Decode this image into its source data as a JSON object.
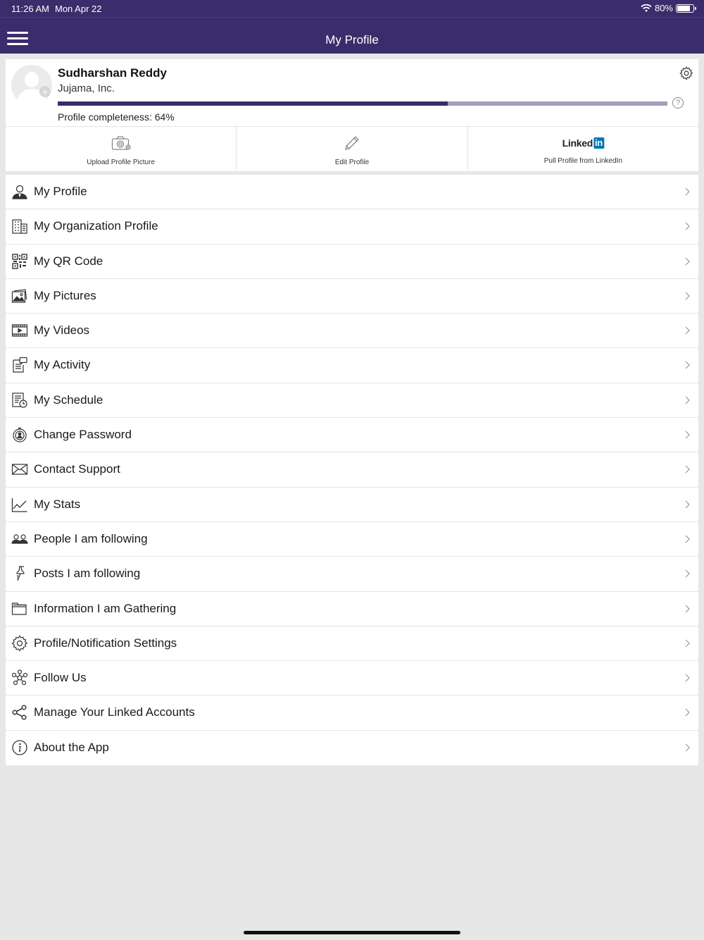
{
  "status_bar": {
    "time": "11:26 AM",
    "date": "Mon Apr 22",
    "battery": "80%",
    "battery_level": 0.8
  },
  "nav": {
    "title": "My Profile",
    "menu_icon": "hamburger-menu-icon"
  },
  "profile": {
    "name": "Sudharshan Reddy",
    "company": "Jujama, Inc.",
    "completeness_label": "Profile completeness: 64%",
    "completeness_value": 0.64,
    "help_label": "?",
    "avatar_plus": "+"
  },
  "actions": [
    {
      "label": "Upload Profile Picture",
      "icon": "camera-icon"
    },
    {
      "label": "Edit Profile",
      "icon": "pencil-icon"
    },
    {
      "label": "Pull Profile from LinkedIn",
      "icon": "linkedin-logo",
      "logo_text": "Linked",
      "logo_in": "in"
    }
  ],
  "menu": [
    {
      "label": "My Profile",
      "icon": "person-icon"
    },
    {
      "label": "My Organization Profile",
      "icon": "building-icon"
    },
    {
      "label": "My QR Code",
      "icon": "qr-code-icon"
    },
    {
      "label": "My Pictures",
      "icon": "pictures-icon"
    },
    {
      "label": "My Videos",
      "icon": "video-icon"
    },
    {
      "label": "My Activity",
      "icon": "activity-icon"
    },
    {
      "label": "My Schedule",
      "icon": "schedule-icon"
    },
    {
      "label": "Change Password",
      "icon": "password-icon"
    },
    {
      "label": "Contact Support",
      "icon": "envelope-icon"
    },
    {
      "label": "My Stats",
      "icon": "stats-icon"
    },
    {
      "label": "People I am following",
      "icon": "people-icon"
    },
    {
      "label": "Posts I am following",
      "icon": "pin-icon"
    },
    {
      "label": "Information I am Gathering",
      "icon": "folder-icon"
    },
    {
      "label": "Profile/Notification Settings",
      "icon": "gear-icon"
    },
    {
      "label": "Follow Us",
      "icon": "social-icon"
    },
    {
      "label": "Manage Your Linked Accounts",
      "icon": "share-icon"
    },
    {
      "label": "About the App",
      "icon": "info-icon"
    }
  ],
  "colors": {
    "header": "#3b2c6b",
    "progress_fill": "#3b2c6b",
    "progress_track": "#a39eba",
    "background": "#e8e7e8",
    "linkedin": "#0077b5"
  }
}
